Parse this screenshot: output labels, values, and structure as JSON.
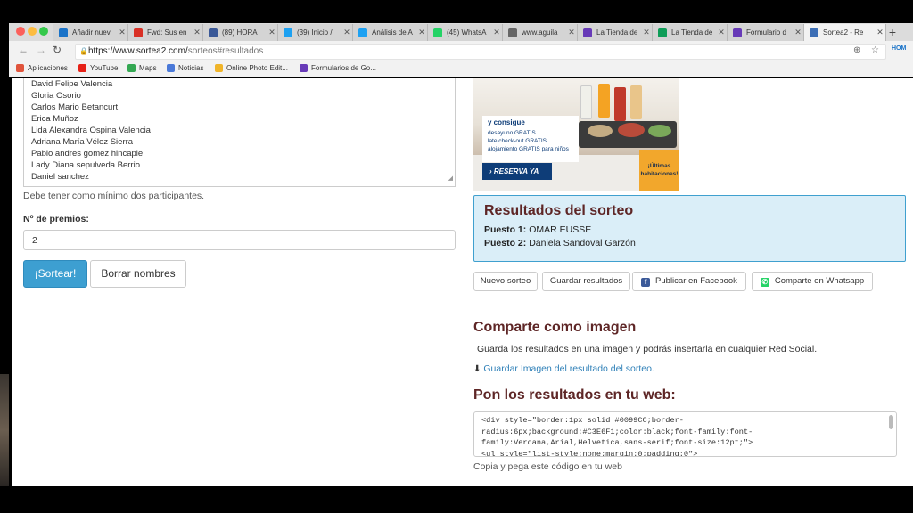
{
  "browser": {
    "tabs": [
      {
        "title": "Añadir nuev",
        "icon": "hom-icon",
        "color": "#1a73c8",
        "active": false
      },
      {
        "title": "Fwd: Sus en",
        "icon": "gmail-icon",
        "color": "#d93025",
        "active": false
      },
      {
        "title": "(89) HORA",
        "icon": "facebook-icon",
        "color": "#3b5998",
        "active": false
      },
      {
        "title": "(39) Inicio /",
        "icon": "twitter-icon",
        "color": "#1da1f2",
        "active": false
      },
      {
        "title": "Análisis de A",
        "icon": "twitter-icon",
        "color": "#1da1f2",
        "active": false
      },
      {
        "title": "(45) WhatsA",
        "icon": "whatsapp-icon",
        "color": "#25d366",
        "active": false
      },
      {
        "title": "www.aguila",
        "icon": "globe-icon",
        "color": "#666666",
        "active": false
      },
      {
        "title": "La Tienda de",
        "icon": "forms-icon",
        "color": "#673ab7",
        "active": false
      },
      {
        "title": "La Tienda de",
        "icon": "sheets-icon",
        "color": "#0f9d58",
        "active": false
      },
      {
        "title": "Formulario d",
        "icon": "forms-icon",
        "color": "#673ab7",
        "active": false
      },
      {
        "title": "Sortea2 - Re",
        "icon": "sortea2-icon",
        "color": "#3d6fb6",
        "active": true
      }
    ],
    "url": "https://www.sortea2.com/sorteos#resultados",
    "url_main": "https://www.sortea2.com/",
    "url_tail": "sorteos#resultados",
    "bookmarks": [
      {
        "label": "Aplicaciones",
        "icon": "apps-icon",
        "color": "#e0543c"
      },
      {
        "label": "YouTube",
        "icon": "youtube-icon",
        "color": "#e62117"
      },
      {
        "label": "Maps",
        "icon": "maps-icon",
        "color": "#34a853"
      },
      {
        "label": "Noticias",
        "icon": "news-icon",
        "color": "#4a79d8"
      },
      {
        "label": "Online Photo Edit...",
        "icon": "photo-editor-icon",
        "color": "#f0b429"
      },
      {
        "label": "Formularios de Go...",
        "icon": "forms-icon",
        "color": "#673ab7"
      }
    ]
  },
  "form": {
    "participants": [
      "David Felipe Valencia",
      "Gloria Osorio",
      "Carlos Mario Betancurt",
      "Erica Muñoz",
      "Lida Alexandra Ospina Valencia",
      "Adriana María Vélez Sierra",
      "Pablo andres gomez hincapie",
      "Lady Diana sepulveda Berrio",
      "Daniel sanchez"
    ],
    "hint": "Debe tener como mínimo dos participantes.",
    "prizes_label": "Nº de premios:",
    "prizes_value": "2",
    "draw_label": "¡Sortear!",
    "clear_label": "Borrar nombres"
  },
  "ad": {
    "heading": "y consigue",
    "lines": [
      "desayuno GRATIS",
      "late check-out GRATIS",
      "alojamiento GRATIS para niños"
    ],
    "cta": "› RESERVA YA",
    "offer": "¡Últimas habitaciones!"
  },
  "results": {
    "title": "Resultados del sorteo",
    "places": [
      {
        "label": "Puesto 1:",
        "name": "OMAR EUSSE"
      },
      {
        "label": "Puesto 2:",
        "name": "Daniela Sandoval Garzón"
      }
    ]
  },
  "actions": {
    "new_draw": "Nuevo sorteo",
    "save_results": "Guardar resultados",
    "facebook": "Publicar en Facebook",
    "whatsapp": "Comparte en Whatsapp"
  },
  "share_image": {
    "title": "Comparte como imagen",
    "desc": "Guarda los resultados en una imagen y podrás insertarla en cualquier Red Social.",
    "link": "Guardar Imagen del resultado del sorteo."
  },
  "embed": {
    "title": "Pon los resultados en tu web:",
    "code": "<div style=\"border:1px solid #0099CC;border-radius:6px;background:#C3E6F1;color:black;font-family:font-family:Verdana,Arial,Helvetica,sans-serif;font-size:12pt;\">\n<ul style=\"list-style:none;margin:0;padding:0\">",
    "copy_hint": "Copia y pega este código en tu web"
  },
  "colors": {
    "accent_blue": "#3d9fd1",
    "results_bg": "#daeef8",
    "heading_brown": "#5e2626",
    "link_blue": "#2f80b8"
  }
}
